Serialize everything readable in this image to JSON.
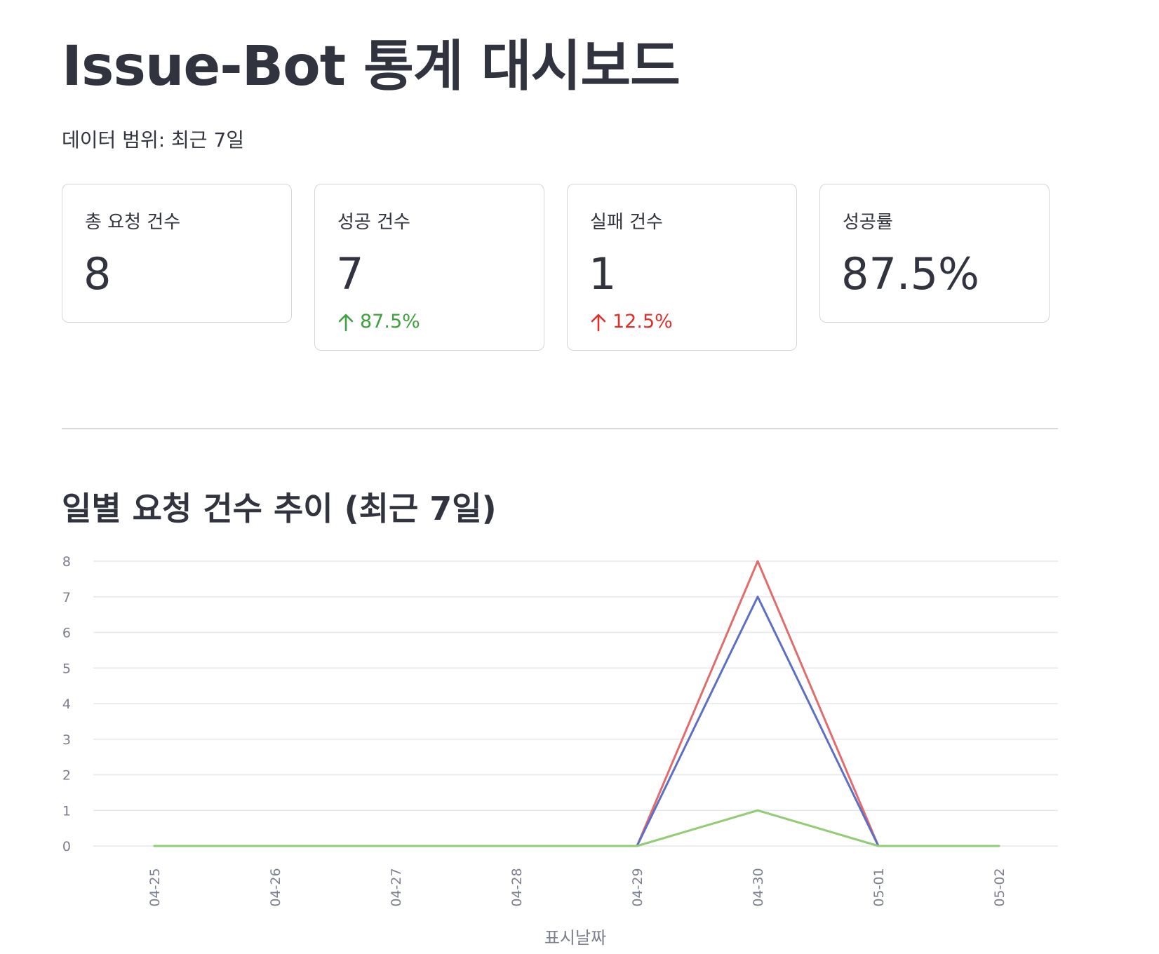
{
  "page": {
    "title": "Issue-Bot 통계 대시보드",
    "data_range": "데이터 범위: 최근 7일"
  },
  "metrics": [
    {
      "label": "총 요청 건수",
      "value": "8",
      "delta": "",
      "delta_direction": "",
      "delta_color": ""
    },
    {
      "label": "성공 건수",
      "value": "7",
      "delta": "87.5%",
      "delta_direction": "up",
      "delta_color": "#3ea03e"
    },
    {
      "label": "실패 건수",
      "value": "1",
      "delta": "12.5%",
      "delta_direction": "up",
      "delta_color": "#e0302c"
    },
    {
      "label": "성공률",
      "value": "87.5%",
      "delta": "",
      "delta_direction": "",
      "delta_color": ""
    }
  ],
  "section": {
    "chart_title": "일별 요청 건수 추이 (최근 7일)"
  },
  "chart_data": {
    "type": "line",
    "title": "일별 요청 건수 추이 (최근 7일)",
    "xlabel": "표시날짜",
    "ylabel": "",
    "x": [
      "04-25",
      "04-26",
      "04-27",
      "04-28",
      "04-29",
      "04-30",
      "05-01",
      "05-02"
    ],
    "ylim": [
      0,
      8
    ],
    "yticks": [
      0,
      1,
      2,
      3,
      4,
      5,
      6,
      7,
      8
    ],
    "grid": true,
    "legend": "none",
    "series": [
      {
        "values": [
          null,
          null,
          null,
          null,
          0,
          8,
          0,
          null
        ],
        "color": "#e06c6c"
      },
      {
        "values": [
          null,
          null,
          null,
          null,
          0,
          7,
          0,
          null
        ],
        "color": "#5c6fc5"
      },
      {
        "values": [
          0,
          0,
          0,
          0,
          0,
          1,
          0,
          0
        ],
        "color": "#92cc74"
      }
    ]
  }
}
